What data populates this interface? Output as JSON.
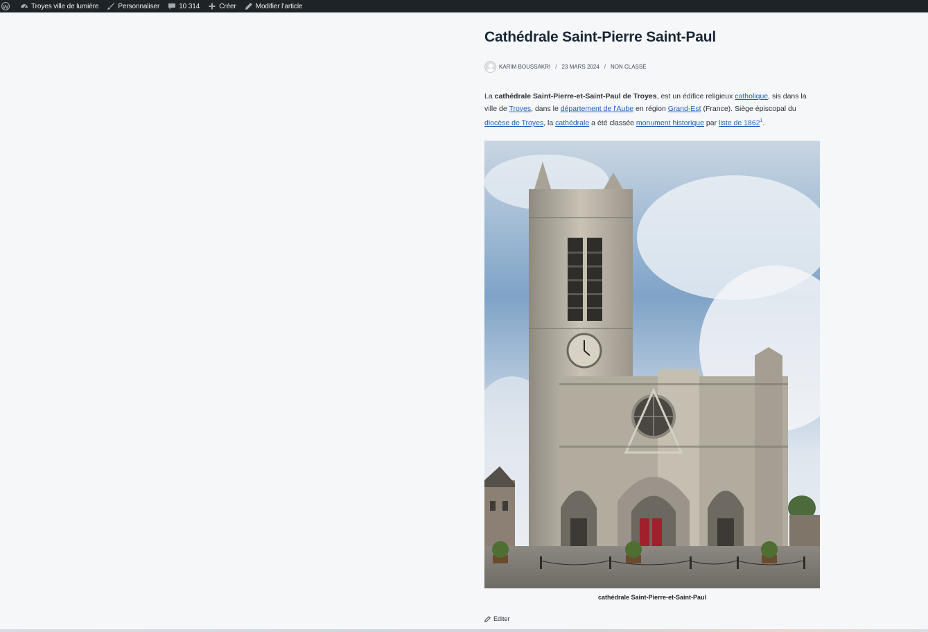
{
  "adminbar": {
    "site_name": "Troyes ville de lumière",
    "customize": "Personnaliser",
    "comments": "10 314",
    "new": "Créer",
    "edit_post": "Modifier l’article"
  },
  "post": {
    "title": "Cathédrale Saint-Pierre Saint-Paul",
    "meta": {
      "author": "KARIM BOUSSAKRI",
      "date": "23 MARS 2024",
      "category": "NON CLASSÉ",
      "separator": "/"
    },
    "content": {
      "p1": "La ",
      "bold": "cathédrale Saint-Pierre-et-Saint-Paul de Troyes",
      "p2": ", est un édifice religieux ",
      "link_catholique": "catholique",
      "p3": ", sis dans la ville de ",
      "link_troyes": "Troyes",
      "p4": ", dans le ",
      "link_departement": "département de l'Aube",
      "p5": " en région ",
      "link_grandest": "Grand-Est",
      "p6": " (France). Siège épiscopal du ",
      "link_diocese": "diocèse de Troyes",
      "p7": ", la ",
      "link_cathedrale": "cathédrale",
      "p8": " a été classée ",
      "link_monument": "monument historique",
      "p9": " par ",
      "link_liste": "liste de 1862",
      "footnote": "1",
      "p10": "."
    },
    "caption": "cathédrale Saint-Pierre-et-Saint-Paul",
    "edit_label": "Editer"
  },
  "icons": {
    "wp_logo": "wordpress-logo-icon",
    "site": "dashboard-icon",
    "customize": "brush-icon",
    "comments": "comment-bubble-icon",
    "new": "plus-icon",
    "edit": "pencil-icon"
  },
  "colors": {
    "adminbar_bg": "#1d2327",
    "link": "#1d5cc5",
    "background": "#f5f7f9",
    "title": "#1b2735"
  }
}
